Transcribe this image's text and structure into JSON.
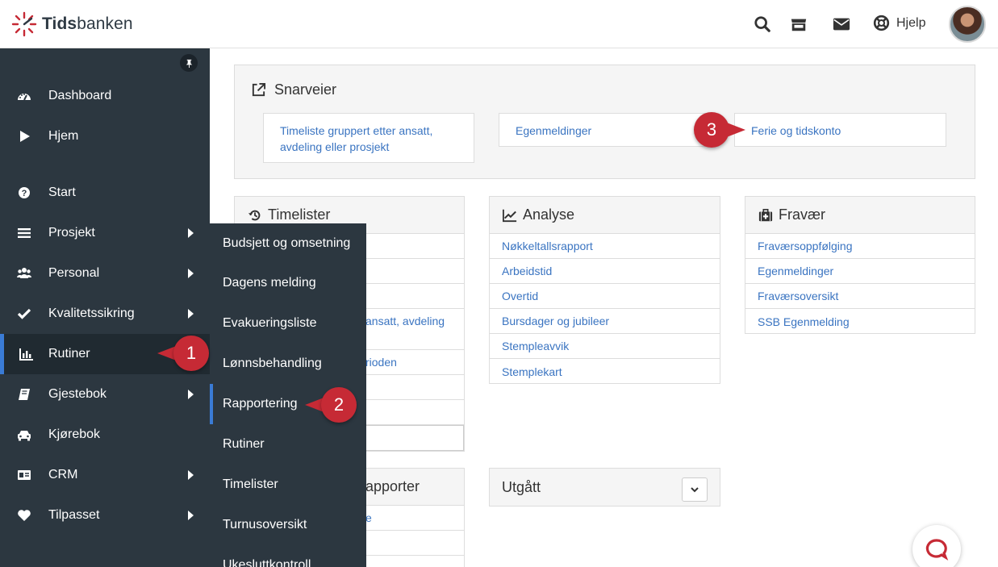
{
  "app": {
    "brand_prefix": "Tids",
    "brand_suffix": "banken"
  },
  "header": {
    "help_label": "Hjelp"
  },
  "sidebar": {
    "items": [
      {
        "label": "Dashboard",
        "icon": "dashboard-icon"
      },
      {
        "label": "Hjem",
        "icon": "play-icon"
      },
      {
        "label": "Start",
        "icon": "question-icon"
      },
      {
        "label": "Prosjekt",
        "icon": "list-icon"
      },
      {
        "label": "Personal",
        "icon": "users-icon"
      },
      {
        "label": "Kvalitetssikring",
        "icon": "check-icon"
      },
      {
        "label": "Rutiner",
        "icon": "bar-chart-icon"
      },
      {
        "label": "Gjestebok",
        "icon": "book-icon"
      },
      {
        "label": "Kjørebok",
        "icon": "car-icon"
      },
      {
        "label": "CRM",
        "icon": "id-card-icon"
      },
      {
        "label": "Tilpasset",
        "icon": "heart-icon"
      }
    ]
  },
  "submenu": {
    "items": [
      "Budsjett og omsetning",
      "Dagens melding",
      "Evakueringsliste",
      "Lønnsbehandling",
      "Rapportering",
      "Rutiner",
      "Timelister",
      "Turnusoversikt",
      "Ukesluttkontroll"
    ]
  },
  "callouts": [
    "1",
    "2",
    "3"
  ],
  "snarveier": {
    "title": "Snarveier",
    "links": [
      "Timeliste gruppert etter ansatt, avdeling eller prosjekt",
      "Egenmeldinger",
      "Ferie og tidskonto"
    ]
  },
  "panels": {
    "timelister": {
      "title": "Timelister",
      "visible_texts": [
        "ansatt, avdeling",
        "rioden"
      ]
    },
    "analyse": {
      "title": "Analyse",
      "items": [
        "Nøkkeltallsrapport",
        "Arbeidstid",
        "Overtid",
        "Bursdager og jubileer",
        "Stempleavvik",
        "Stemplekart"
      ]
    },
    "fravaer": {
      "title": "Fravær",
      "items": [
        "Fraværsoppfølging",
        "Egenmeldinger",
        "Fraværsoversikt",
        "SSB Egenmelding"
      ]
    },
    "rapporter": {
      "title": "apporter",
      "row_text": "e"
    },
    "utgatt": {
      "title": "Utgått"
    }
  },
  "colors": {
    "sidebar": "#2c3740",
    "accent": "#3a7bd5",
    "link": "#3a74c1",
    "callout": "#c62a35"
  }
}
